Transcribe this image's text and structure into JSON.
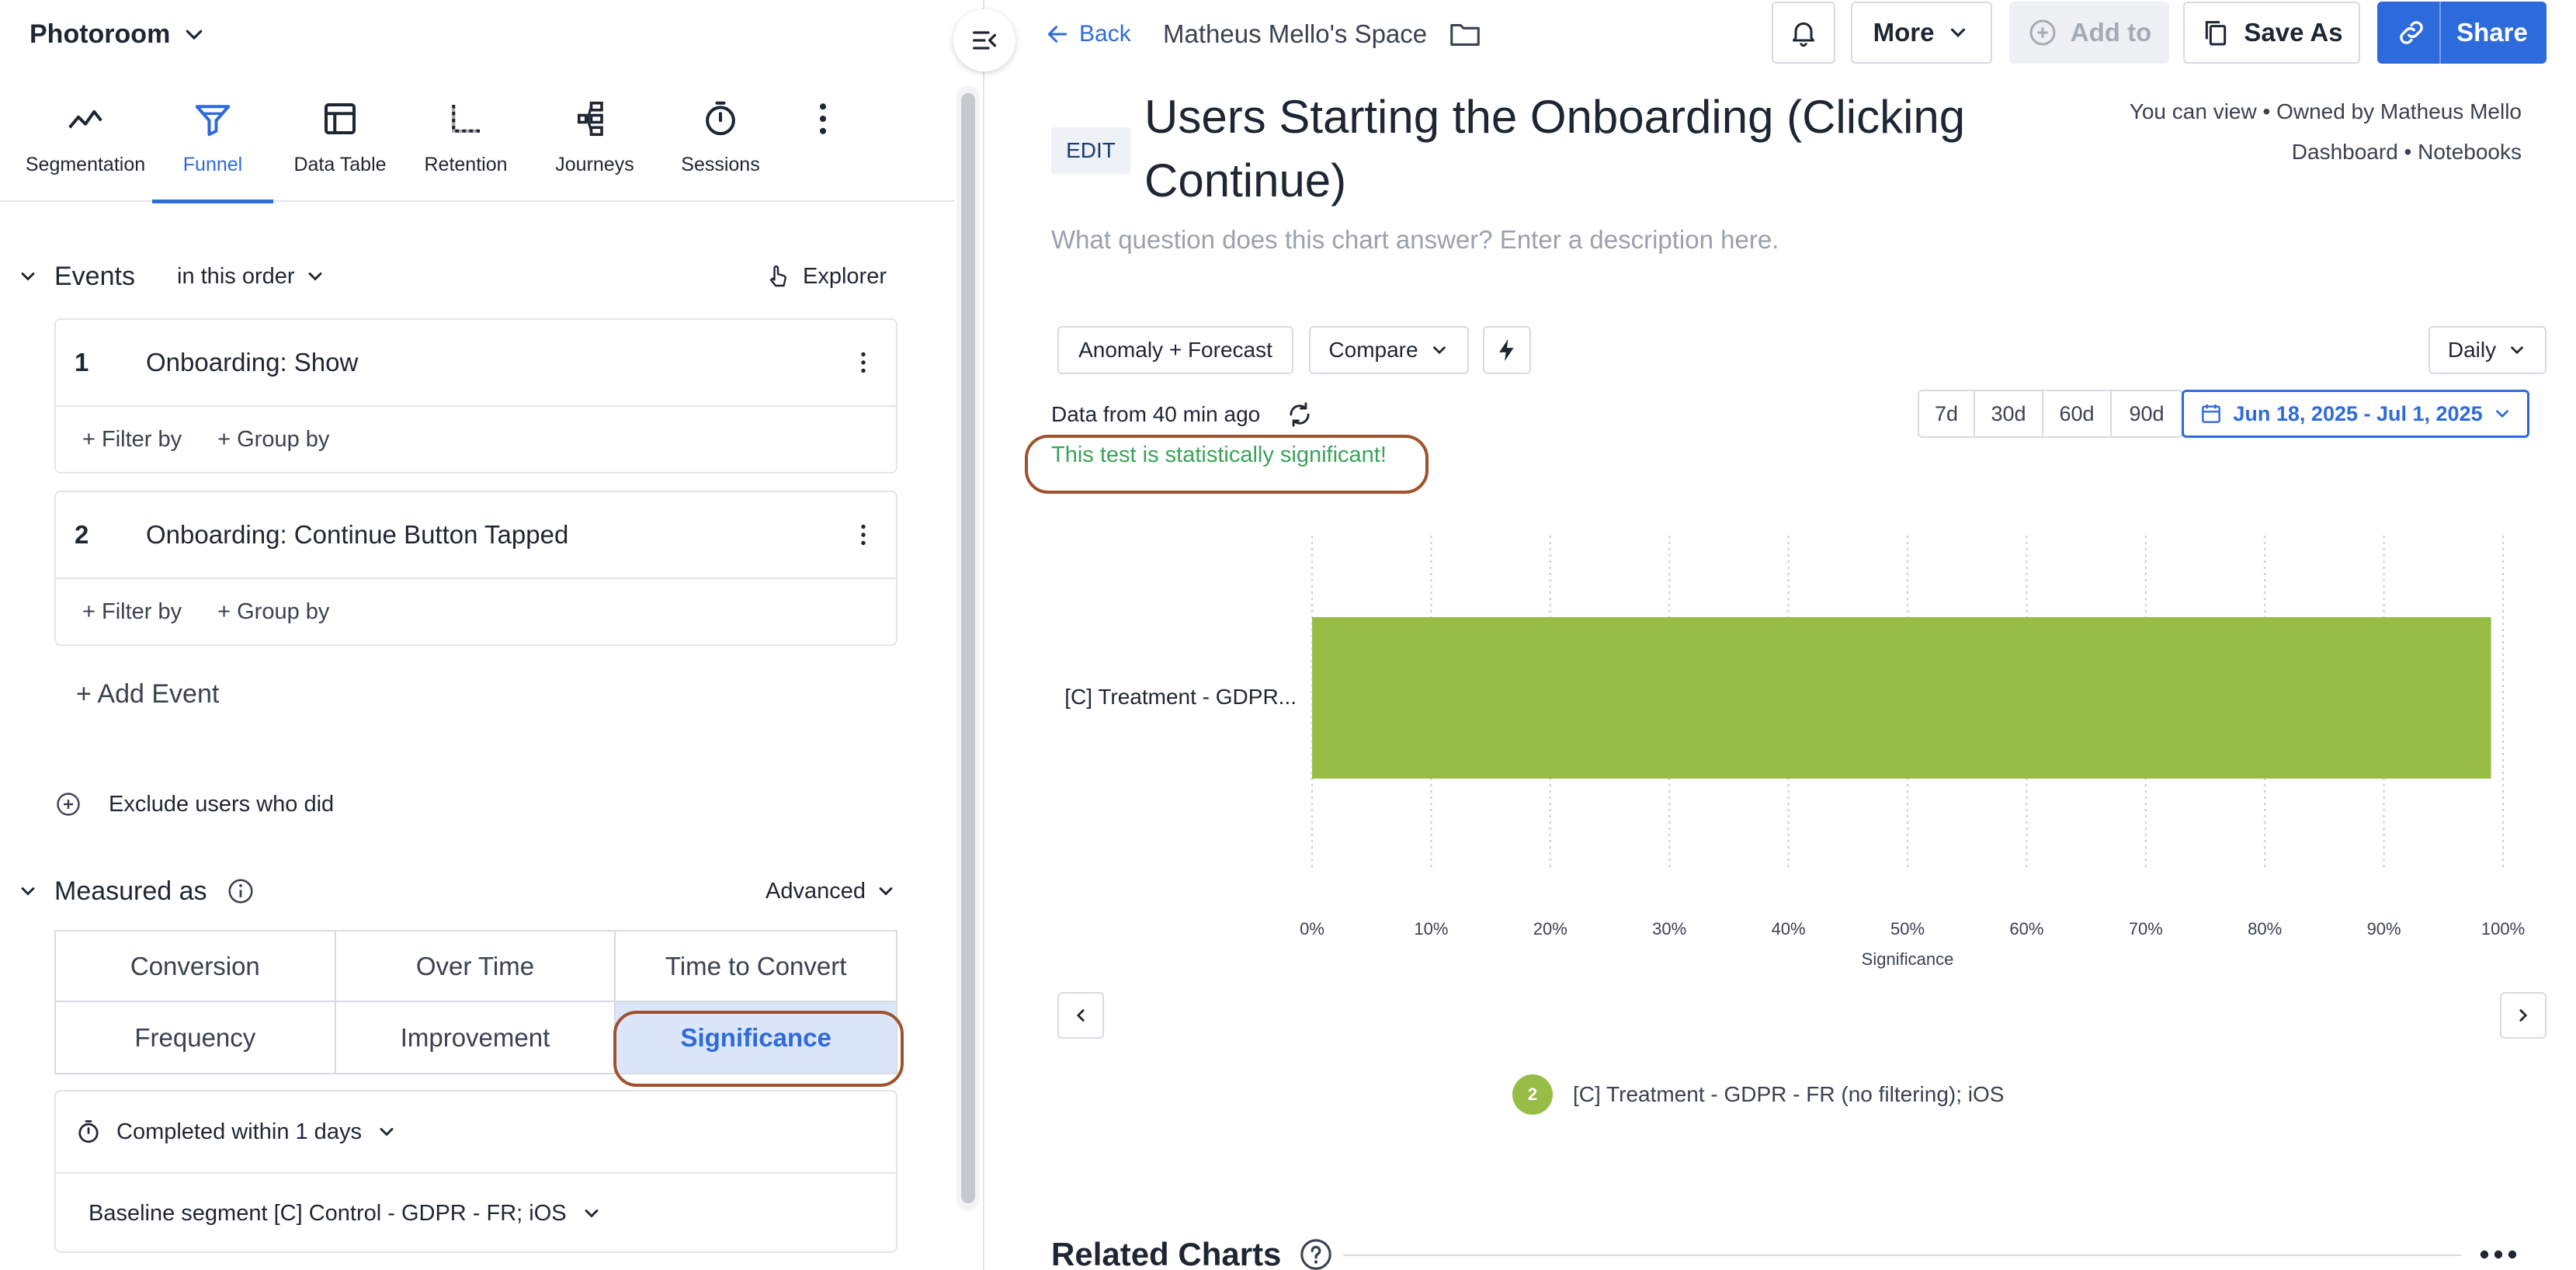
{
  "app": {
    "title": "Photoroom"
  },
  "tools": [
    {
      "label": "Segmentation",
      "icon": "segmentation-icon"
    },
    {
      "label": "Funnel",
      "icon": "funnel-icon",
      "active": true
    },
    {
      "label": "Data Table",
      "icon": "data-table-icon"
    },
    {
      "label": "Retention",
      "icon": "retention-icon"
    },
    {
      "label": "Journeys",
      "icon": "journeys-icon"
    },
    {
      "label": "Sessions",
      "icon": "sessions-icon"
    }
  ],
  "events_section": {
    "title": "Events",
    "order": "in this order",
    "explorer": "Explorer",
    "events": [
      {
        "num": "1",
        "name": "Onboarding: Show"
      },
      {
        "num": "2",
        "name": "Onboarding: Continue Button Tapped"
      }
    ],
    "filter_by": "+ Filter by",
    "group_by": "+ Group by",
    "add_event": "+ Add Event",
    "exclude": "Exclude users who did"
  },
  "measured": {
    "title": "Measured as",
    "advanced": "Advanced",
    "options": [
      "Conversion",
      "Over Time",
      "Time to Convert",
      "Frequency",
      "Improvement",
      "Significance"
    ],
    "selected": "Significance",
    "completed_within": "Completed within 1 days",
    "baseline": "Baseline segment [C] Control - GDPR - FR; iOS"
  },
  "header": {
    "back": "Back",
    "space": "Matheus Mello's Space",
    "more": "More",
    "add_to": "Add to",
    "save_as": "Save As",
    "share": "Share"
  },
  "chart_header": {
    "edit": "EDIT",
    "title_line1": "Users Starting the Onboarding (Clicking",
    "title_line2": "Continue)",
    "owner_line1": "You can view • Owned by Matheus Mello",
    "owner_line2": "Dashboard • Notebooks",
    "description_placeholder": "What question does this chart answer? Enter a description here."
  },
  "controls": {
    "anomaly": "Anomaly + Forecast",
    "compare": "Compare",
    "interval": "Daily",
    "data_from": "Data from 40 min ago",
    "significance_msg": "This test is statistically significant!",
    "ranges": [
      "7d",
      "30d",
      "60d",
      "90d"
    ],
    "date_range": "Jun 18, 2025 - Jul 1, 2025"
  },
  "chart_data": {
    "type": "bar",
    "orientation": "horizontal",
    "categories": [
      "[C] Treatment - GDPR..."
    ],
    "values": [
      99
    ],
    "xlabel": "Significance",
    "xlim": [
      0,
      100
    ],
    "xticks": [
      "0%",
      "10%",
      "20%",
      "30%",
      "40%",
      "50%",
      "60%",
      "70%",
      "80%",
      "90%",
      "100%"
    ],
    "grid": "vertical dashed",
    "bar_color": "#97bd47"
  },
  "legend": {
    "num": "2",
    "label": "[C] Treatment - GDPR -  FR (no filtering); iOS"
  },
  "related": {
    "title": "Related Charts"
  },
  "colors": {
    "accent": "#2d6bdc",
    "success": "#3aa35a",
    "bar": "#97bd47",
    "highlight_ring": "#a0522d"
  }
}
